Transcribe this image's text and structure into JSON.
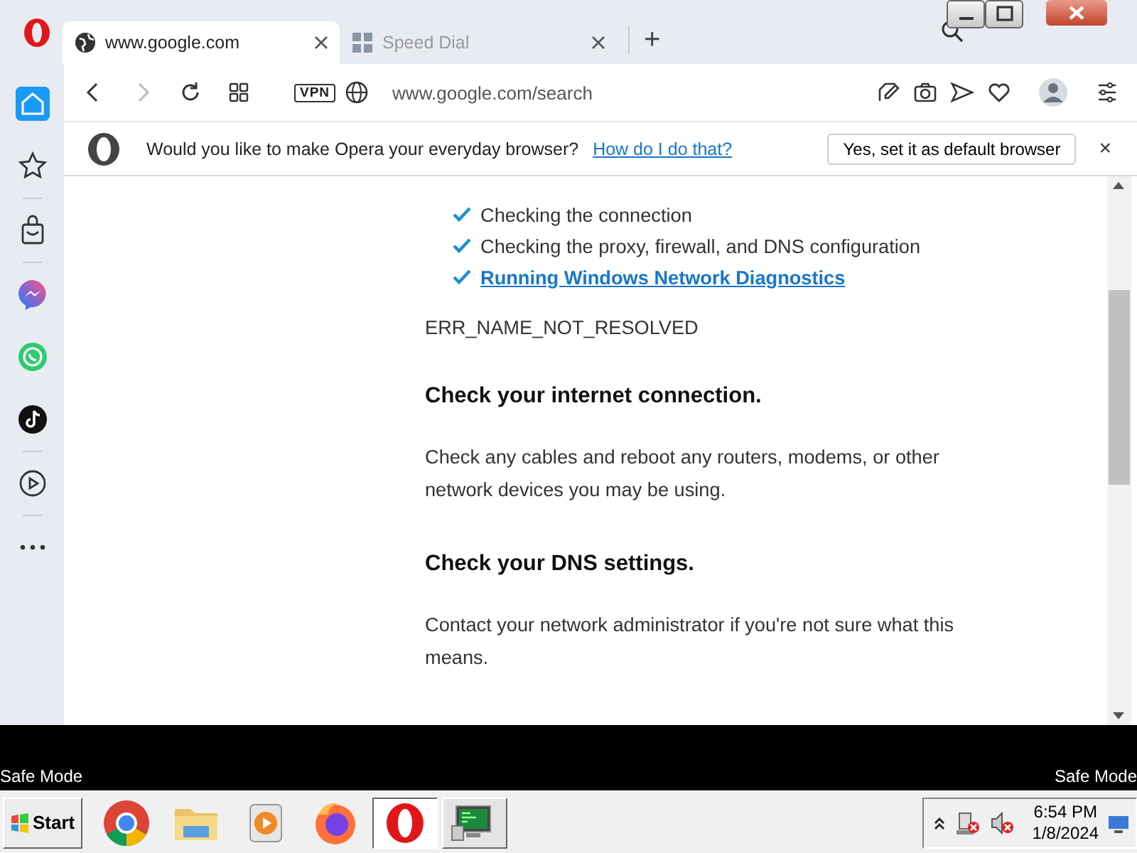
{
  "browser": {
    "tabs": [
      {
        "title": "www.google.com",
        "kind": "globe",
        "selected": true
      },
      {
        "title": "Speed Dial",
        "kind": "grid",
        "selected": false
      }
    ],
    "new_tab": "+",
    "vpn": "VPN",
    "address": "www.google.com/search",
    "banner": {
      "message": "Would you like to make Opera your everyday browser?",
      "link": "How do I do that?",
      "button": "Yes, set it as default browser",
      "close": "×"
    },
    "sidebar": {
      "items": [
        {
          "kind": "home",
          "selected": true
        },
        {
          "kind": "star",
          "selected": false
        },
        {
          "kind": "bag",
          "selected": false
        },
        {
          "kind": "messenger",
          "selected": false
        },
        {
          "kind": "whatsapp",
          "selected": false
        },
        {
          "kind": "tiktok",
          "selected": false
        },
        {
          "kind": "player",
          "selected": false
        },
        {
          "kind": "more",
          "selected": false
        }
      ]
    },
    "page": {
      "checks": [
        {
          "text": "Checking the connection",
          "kind": "text"
        },
        {
          "text": "Checking the proxy, firewall, and DNS configuration",
          "kind": "text"
        },
        {
          "text": "Running Windows Network Diagnostics",
          "kind": "link"
        }
      ],
      "error_code": "ERR_NAME_NOT_RESOLVED",
      "sections": [
        {
          "heading": "Check your internet connection.",
          "body": "Check any cables and reboot any routers, modems, or other network devices you may be using."
        },
        {
          "heading": "Check your DNS settings.",
          "body": "Contact your network administrator if you're not sure what this means."
        }
      ]
    }
  },
  "desktop": {
    "labels": [
      "Safe Mode",
      "Safe Mode"
    ]
  },
  "taskbar": {
    "start": "Start",
    "apps": [
      {
        "kind": "chrome",
        "selected": false
      },
      {
        "kind": "folder",
        "selected": false
      },
      {
        "kind": "media",
        "selected": false
      },
      {
        "kind": "firefox",
        "selected": false
      },
      {
        "kind": "opera",
        "selected": true
      },
      {
        "kind": "monitor",
        "selected": false
      }
    ],
    "time": "6:54 PM",
    "date": "1/8/2024"
  }
}
